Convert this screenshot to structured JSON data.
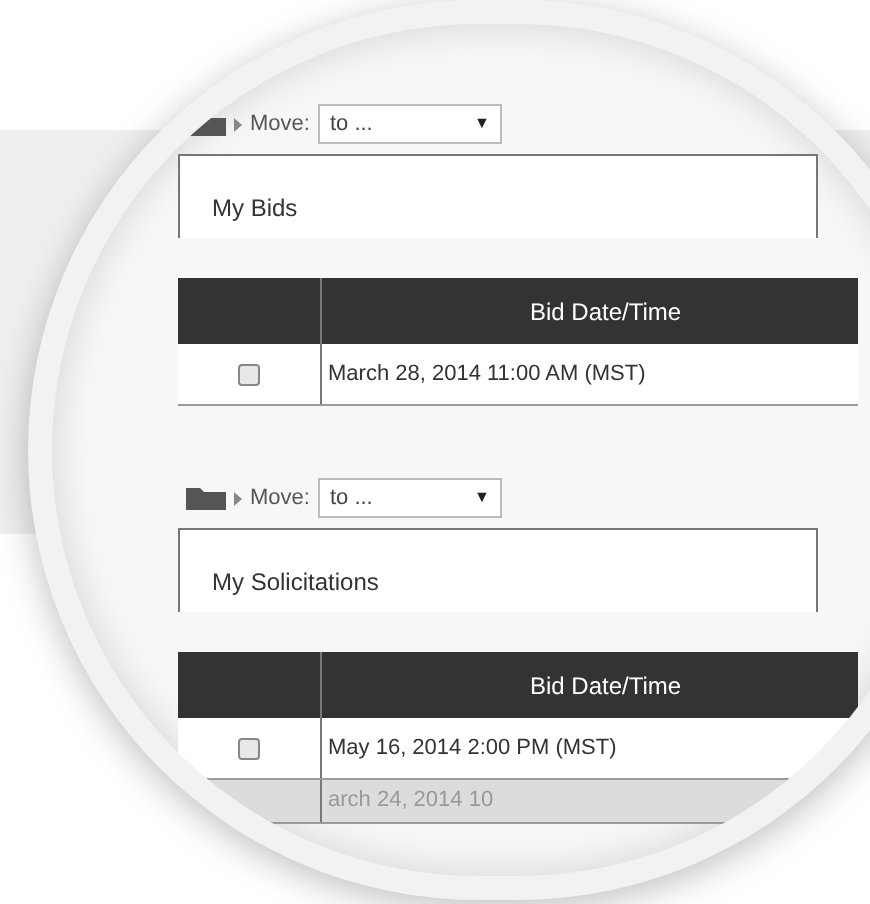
{
  "sections": [
    {
      "move_label": "Move:",
      "move_value": "to ...",
      "caret": "▼",
      "title": "My Bids",
      "column": "Bid Date/Time",
      "rows": [
        {
          "kind": "normal",
          "date": "March 28, 2014 11:00 AM (MST)",
          "checked": false
        }
      ]
    },
    {
      "move_label": "Move:",
      "move_value": "to ...",
      "caret": "▼",
      "title": "My Solicitations",
      "column": "Bid Date/Time",
      "rows": [
        {
          "kind": "normal",
          "date": "May 16, 2014 2:00 PM (MST)",
          "checked": false
        },
        {
          "kind": "faded",
          "date": "arch 24, 2014 10"
        }
      ]
    }
  ]
}
